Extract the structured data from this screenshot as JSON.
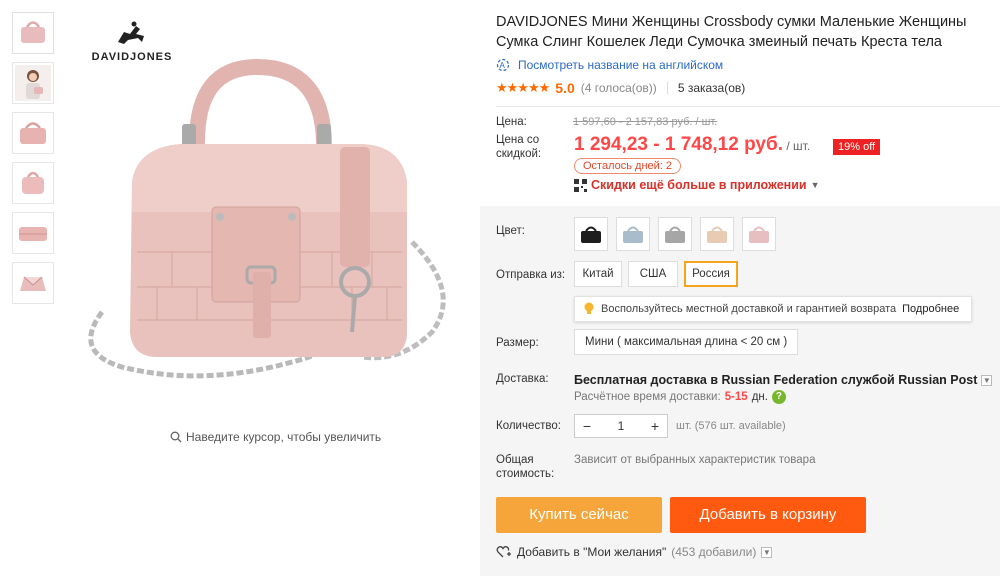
{
  "brand": {
    "name": "DAVIDJONES"
  },
  "thumbnails": [
    {
      "icon": "bag-front"
    },
    {
      "icon": "model-photo"
    },
    {
      "icon": "bag-angle"
    },
    {
      "icon": "bag-side"
    },
    {
      "icon": "bag-top"
    },
    {
      "icon": "bag-inside"
    }
  ],
  "main_image": {
    "zoom_hint": "Наведите курсор, чтобы увеличить"
  },
  "product": {
    "title": "DAVIDJONES Мини Женщины Crossbody сумки Маленькие Женщины Сумка Слинг Кошелек Леди Сумочка змеиный печать Креста тела",
    "translate_link": "Посмотреть название на английском",
    "stars": "★★★★★",
    "rating": "5.0",
    "votes": "(4 голоса(ов))",
    "orders": "5 заказа(ов)"
  },
  "price": {
    "label": "Цена:",
    "old_value": "1 597,60 - 2 157,83 руб. / шт.",
    "discount_label_1": "Цена со",
    "discount_label_2": "скидкой:",
    "new_value": "1 294,23 - 1 748,12 руб.",
    "unit": " / шт.",
    "discount_badge": "19% off",
    "days_left": "Осталось дней: 2",
    "app_deal": "Скидки ещё больше в приложении"
  },
  "options": {
    "color_label": "Цвет:",
    "colors": [
      {
        "name": "black",
        "hex": "#1e1e1e"
      },
      {
        "name": "grey-blue",
        "hex": "#a9bccb"
      },
      {
        "name": "grey",
        "hex": "#a6a6a6"
      },
      {
        "name": "beige",
        "hex": "#e7cbb3"
      },
      {
        "name": "pink",
        "hex": "#e8bfc0"
      }
    ],
    "ship_from_label": "Отправка из:",
    "ship_from": [
      "Китай",
      "США",
      "Россия"
    ],
    "ship_from_selected": "Россия",
    "tip_text": "Воспользуйтесь местной доставкой и гарантией возврата",
    "tip_more": "Подробнее",
    "size_label": "Размер:",
    "size_value": "Мини ( максимальная длина < 20 см )"
  },
  "shipping": {
    "label": "Доставка:",
    "text": "Бесплатная доставка в Russian Federation службой Russian Post",
    "time_label": "Расчётное время доставки:",
    "time_days": "5-15",
    "time_unit": "дн."
  },
  "quantity": {
    "label": "Количество:",
    "minus": "−",
    "value": "1",
    "plus": "+",
    "available": "шт. (576 шт. available)"
  },
  "total": {
    "label_1": "Общая",
    "label_2": "стоимость:",
    "text": "Зависит от выбранных характеристик товара"
  },
  "actions": {
    "buy_now": "Купить сейчас",
    "add_to_cart": "Добавить в корзину",
    "wishlist": "Добавить в \"Мои желания\"",
    "wishlist_count": "(453 добавили)"
  }
}
